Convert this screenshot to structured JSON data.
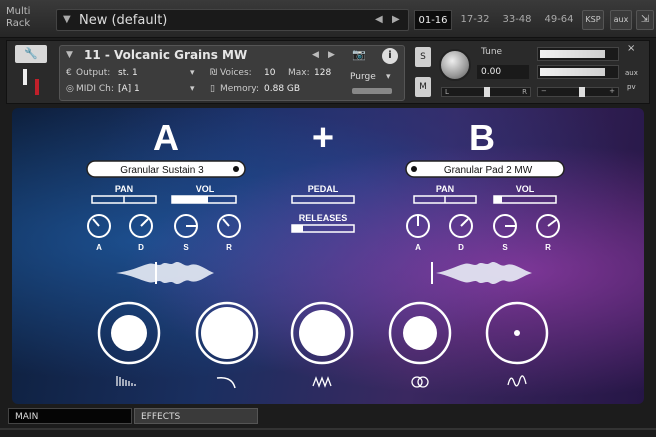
{
  "rack": {
    "label": "Multi Rack",
    "preset_name": "New (default)",
    "page_tabs": [
      "01-16",
      "17-32",
      "33-48",
      "49-64"
    ],
    "active_tab": "01-16",
    "ksp": "KSP",
    "aux": "aux"
  },
  "instrument": {
    "name": "11 - Volcanic Grains MW",
    "output_label": "Output:",
    "output_value": "st. 1",
    "midi_label": "MIDI Ch:",
    "midi_value": "[A] 1",
    "voices_label": "Voices:",
    "voices_value": "10",
    "max_label": "Max:",
    "max_value": "128",
    "memory_label": "Memory:",
    "memory_value": "0.88 GB",
    "purge": "Purge",
    "solo": "S",
    "mute": "M",
    "tune_label": "Tune",
    "tune_value": "0.00",
    "pan_l": "L",
    "pan_r": "R",
    "aux_label": "aux",
    "pv_label": "pv",
    "close": "×",
    "meter_levels": [
      0.85,
      0.85
    ],
    "volume_level": 0.55
  },
  "main": {
    "layer_a": {
      "letter": "A",
      "preset": "Granular Sustain 3",
      "pan": "PAN",
      "vol": "VOL",
      "knob_labels": [
        "A",
        "D",
        "S",
        "R"
      ]
    },
    "plus": "+",
    "pedal": "PEDAL",
    "releases": "RELEASES",
    "layer_b": {
      "letter": "B",
      "preset": "Granular Pad 2 MW",
      "pan": "PAN",
      "vol": "VOL",
      "knob_labels": [
        "A",
        "D",
        "S",
        "R"
      ]
    },
    "big_buttons": [
      {
        "name": "grain-density-button",
        "icon": "ramp-bars-icon"
      },
      {
        "name": "envelope-curve-button",
        "icon": "curve-icon"
      },
      {
        "name": "texture-button",
        "icon": "zigzag-icon"
      },
      {
        "name": "stereo-button",
        "icon": "double-circle-icon"
      },
      {
        "name": "modulation-button",
        "icon": "sine-wave-icon"
      }
    ]
  },
  "tabs": {
    "main": "MAIN",
    "effects": "EFFECTS"
  },
  "colors": {
    "accent": "#ffffff",
    "panel_bg": "#2a2a2a"
  }
}
